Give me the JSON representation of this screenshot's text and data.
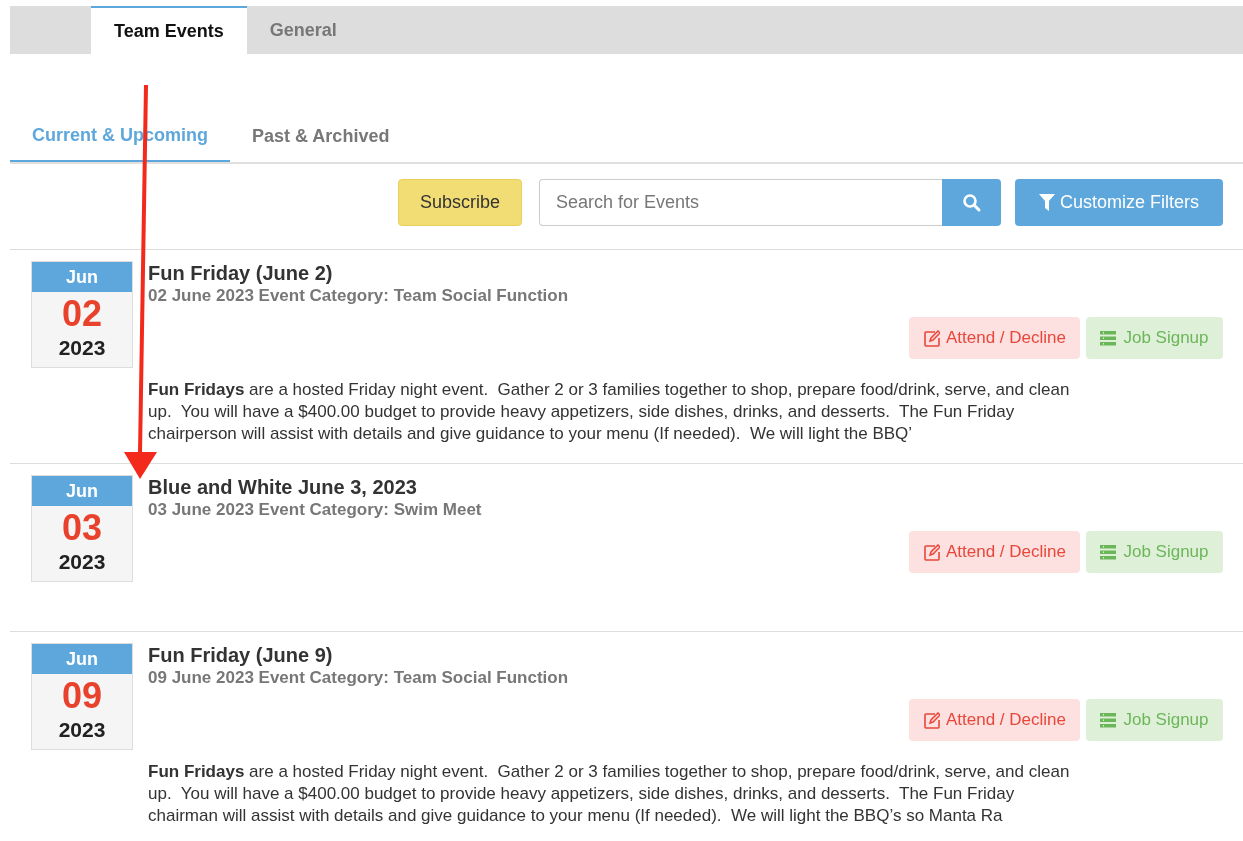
{
  "top_tabs": [
    {
      "label": "Team Events",
      "selected": true
    },
    {
      "label": "General",
      "selected": false
    }
  ],
  "sub_tabs": [
    {
      "label": "Current & Upcoming",
      "selected": true
    },
    {
      "label": "Past & Archived",
      "selected": false
    }
  ],
  "toolbar": {
    "subscribe": "Subscribe",
    "search": {
      "placeholder": "Search for Events"
    },
    "filters": "Customize Filters"
  },
  "events": [
    {
      "month": "Jun",
      "day": "02",
      "year": "2023",
      "title": "Fun Friday (June 2)",
      "subtitle": "02 June 2023 Event Category: Team Social Function",
      "buttons": [
        {
          "kind": "attend",
          "label": "Attend / Decline"
        },
        {
          "kind": "job",
          "label": "Job Signup"
        }
      ],
      "description": "**Fun Fridays** are a hosted Friday night event.  Gather 2 or 3 families together to shop, prepare food/drink, serve, and clean\nup.  You will have a $400.00 budget to provide heavy appetizers, side dishes, drinks, and desserts.  The Fun Friday\nchairperson will assist with details and give guidance to your menu (If needed).  We will light the BBQ’"
    },
    {
      "month": "Jun",
      "day": "03",
      "year": "2023",
      "title": "Blue and White June 3, 2023",
      "subtitle": "03 June 2023 Event Category: Swim Meet",
      "buttons": [
        {
          "kind": "attend",
          "label": "Attend / Decline"
        },
        {
          "kind": "job",
          "label": "Job Signup"
        }
      ]
    },
    {
      "month": "Jun",
      "day": "09",
      "year": "2023",
      "title": "Fun Friday (June 9)",
      "subtitle": "09 June 2023 Event Category: Team Social Function",
      "buttons": [
        {
          "kind": "attend",
          "label": "Attend / Decline"
        },
        {
          "kind": "job",
          "label": "Job Signup"
        }
      ],
      "description": "**Fun Fridays** are a hosted Friday night event.  Gather 2 or 3 families together to shop, prepare food/drink, serve, and clean\nup.  You will have a $400.00 budget to provide heavy appetizers, side dishes, drinks, and desserts.  The Fun Friday\nchairman will assist with details and give guidance to your menu (If needed).  We will light the BBQ’s so Manta Ra"
    }
  ],
  "annotations": [
    {
      "kind": "arrow"
    }
  ]
}
